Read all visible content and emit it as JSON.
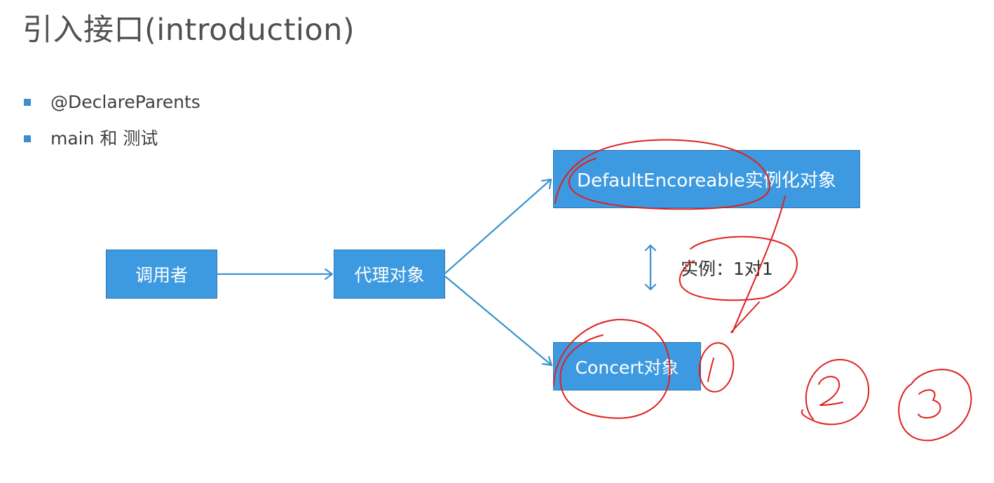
{
  "slide": {
    "title": "引入接口(introduction)",
    "bullets": [
      "@DeclareParents",
      "main 和 测试"
    ]
  },
  "diagram": {
    "nodes": {
      "caller": "调用者",
      "proxy": "代理对象",
      "default_impl": "DefaultEncoreable实例化对象",
      "concert": "Concert对象"
    },
    "relation_label": "实例：1对1",
    "edges": [
      {
        "from": "caller",
        "to": "proxy"
      },
      {
        "from": "proxy",
        "to": "default_impl"
      },
      {
        "from": "proxy",
        "to": "concert"
      }
    ]
  },
  "colors": {
    "box_fill": "#3d9ae0",
    "box_border": "#2a78b8",
    "arrow": "#3a93cf",
    "annotation": "#e02020",
    "bullet": "#3b8fcf"
  },
  "annotations": {
    "numbers": [
      "1",
      "2",
      "3"
    ]
  }
}
